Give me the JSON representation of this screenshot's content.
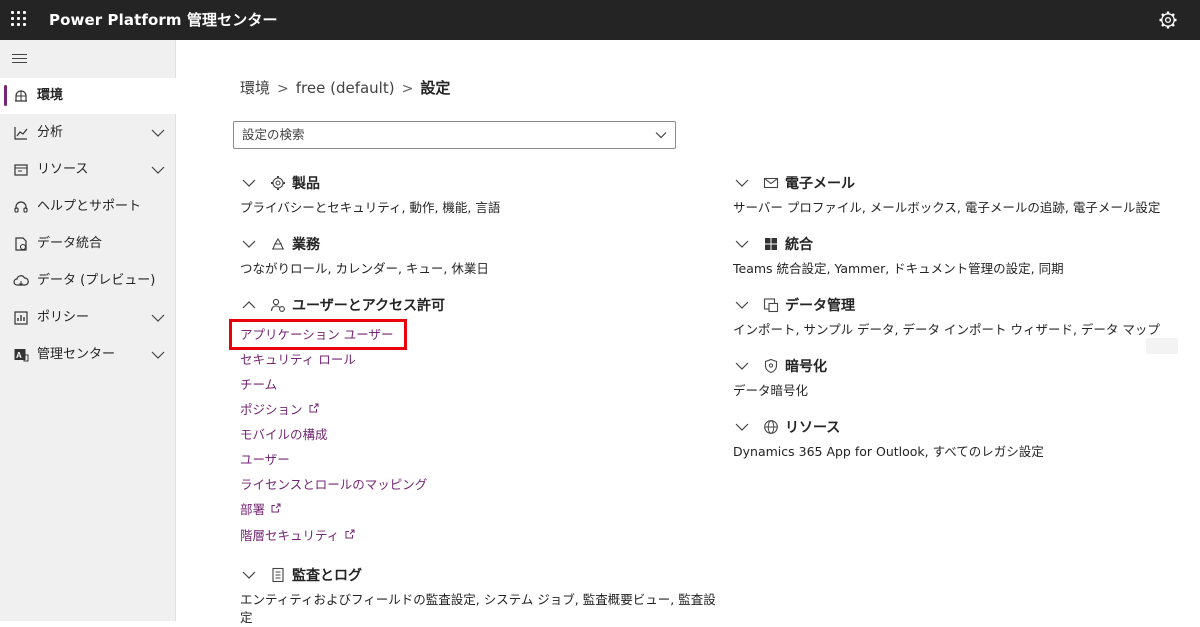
{
  "app": {
    "title": "Power Platform 管理センター"
  },
  "nav": {
    "items": [
      {
        "label": "環境",
        "icon": "environment-icon",
        "selected": true,
        "expandable": false
      },
      {
        "label": "分析",
        "icon": "analytics-icon",
        "selected": false,
        "expandable": true
      },
      {
        "label": "リソース",
        "icon": "resources-icon",
        "selected": false,
        "expandable": true
      },
      {
        "label": "ヘルプとサポート",
        "icon": "headset-icon",
        "selected": false,
        "expandable": false
      },
      {
        "label": "データ統合",
        "icon": "data-integration-icon",
        "selected": false,
        "expandable": false
      },
      {
        "label": "データ (プレビュー)",
        "icon": "cloud-data-icon",
        "selected": false,
        "expandable": false
      },
      {
        "label": "ポリシー",
        "icon": "policy-icon",
        "selected": false,
        "expandable": true
      },
      {
        "label": "管理センター",
        "icon": "admin-center-icon",
        "selected": false,
        "expandable": true
      }
    ]
  },
  "breadcrumb": {
    "root": "環境",
    "env": "free (default)",
    "current": "設定"
  },
  "search": {
    "placeholder": "設定の検索"
  },
  "sections": {
    "products": {
      "title": "製品",
      "icon": "gear-icon",
      "desc": "プライバシーとセキュリティ, 動作, 機能, 言語"
    },
    "business": {
      "title": "業務",
      "icon": "business-icon",
      "desc": "つながりロール, カレンダー, キュー, 休業日"
    },
    "users": {
      "title": "ユーザーとアクセス許可",
      "icon": "users-permissions-icon",
      "links": [
        {
          "label": "アプリケーション ユーザー",
          "external": false
        },
        {
          "label": "セキュリティ ロール",
          "external": false
        },
        {
          "label": "チーム",
          "external": false
        },
        {
          "label": "ポジション",
          "external": true
        },
        {
          "label": "モバイルの構成",
          "external": false
        },
        {
          "label": "ユーザー",
          "external": false
        },
        {
          "label": "ライセンスとロールのマッピング",
          "external": false
        },
        {
          "label": "部署",
          "external": true
        },
        {
          "label": "階層セキュリティ",
          "external": true
        }
      ]
    },
    "audit": {
      "title": "監査とログ",
      "icon": "audit-log-icon",
      "desc1": "エンティティおよびフィールドの監査設定, システム ジョブ, 監査概要ビュー, 監査設",
      "desc2": "定"
    },
    "email": {
      "title": "電子メール",
      "icon": "mail-icon",
      "desc": "サーバー プロファイル, メールボックス, 電子メールの追跡, 電子メール設定"
    },
    "integration": {
      "title": "統合",
      "icon": "windows-logo-icon",
      "desc": "Teams 統合設定, Yammer, ドキュメント管理の設定, 同期"
    },
    "data_mgmt": {
      "title": "データ管理",
      "icon": "data-management-icon",
      "desc": "インポート, サンプル データ, データ インポート ウィザード, データ マップ"
    },
    "encryption": {
      "title": "暗号化",
      "icon": "shield-icon",
      "desc": "データ暗号化"
    },
    "resources": {
      "title": "リソース",
      "icon": "globe-icon",
      "desc": "Dynamics 365 App for Outlook, すべてのレガシ設定"
    }
  },
  "colors": {
    "topbar": "#242424",
    "accent": "#742774",
    "link": "#742774",
    "highlight": "#e8000b"
  }
}
